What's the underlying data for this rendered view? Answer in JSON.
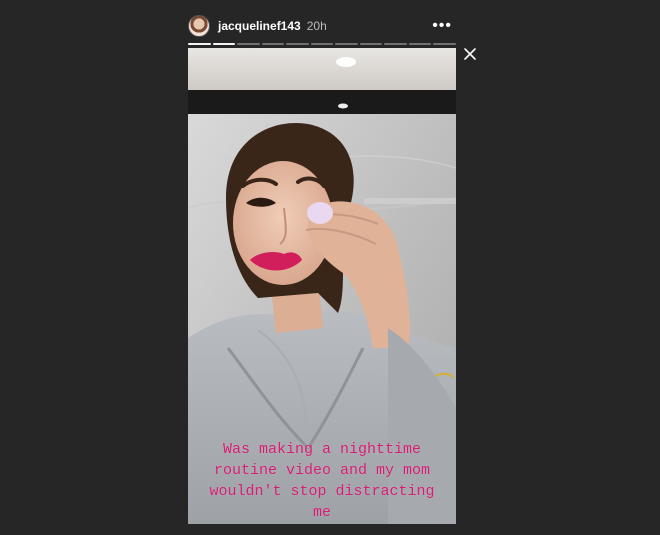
{
  "story": {
    "username": "jacquelinef143",
    "time_ago": "20h",
    "caption": "Was making a nighttime routine video and my mom wouldn't stop distracting me",
    "progress": {
      "total_segments": 11,
      "completed_segments": 2
    },
    "colors": {
      "caption": "#d81b74",
      "background": "#262626"
    }
  },
  "icons": {
    "more": "more-options-icon",
    "close": "close-icon",
    "avatar": "profile-avatar"
  }
}
